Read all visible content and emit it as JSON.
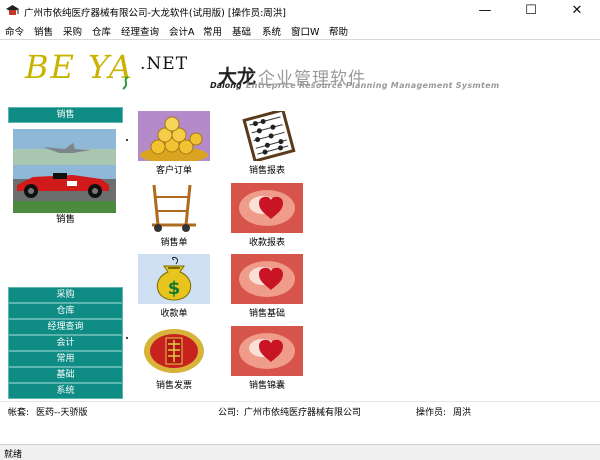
{
  "window": {
    "title": "广州市依纯医疗器械有限公司-大龙软件(试用版) [操作员:周洪]",
    "minimize_glyph": "—",
    "maximize_glyph": "☐",
    "close_glyph": "✕"
  },
  "menu": [
    "命令",
    "销售",
    "采购",
    "仓库",
    "经理查询",
    "会计A",
    "常用",
    "基础",
    "系统",
    "窗口W",
    "帮助"
  ],
  "header": {
    "logo_text": "BE YA",
    "logo_suffix": ".NET",
    "title_cn_primary": "大龙",
    "title_cn_secondary": "企业管理软件",
    "title_en_primary": "Dalong",
    "title_en_secondary": "Entreprice Resource Planning Management Sysmtem"
  },
  "sidebar": {
    "active_section": "销售",
    "active_label": "销售",
    "sections": [
      "采购",
      "仓库",
      "经理查询",
      "会计",
      "常用",
      "基础",
      "系统"
    ]
  },
  "tiles": [
    {
      "label": "客户订单",
      "icon": "coins-icon"
    },
    {
      "label": "销售报表",
      "icon": "abacus-icon"
    },
    {
      "label": "销售单",
      "icon": "hand-truck-icon"
    },
    {
      "label": "收款报表",
      "icon": "heart-icon"
    },
    {
      "label": "收款单",
      "icon": "money-bag-icon"
    },
    {
      "label": "销售基础",
      "icon": "heart-icon"
    },
    {
      "label": "销售发票",
      "icon": "invoice-emblem-icon"
    },
    {
      "label": "销售锦囊",
      "icon": "heart-icon"
    }
  ],
  "info": {
    "account_label": "帐套:",
    "account_value": "医药--天骄版",
    "company_label": "公司:",
    "company_value": "广州市依纯医疗器械有限公司",
    "operator_label": "操作员:",
    "operator_value": "周洪"
  },
  "status": "就绪",
  "colors": {
    "sidebar_teal": "#0f8c84",
    "logo_gold": "#c8b400"
  }
}
